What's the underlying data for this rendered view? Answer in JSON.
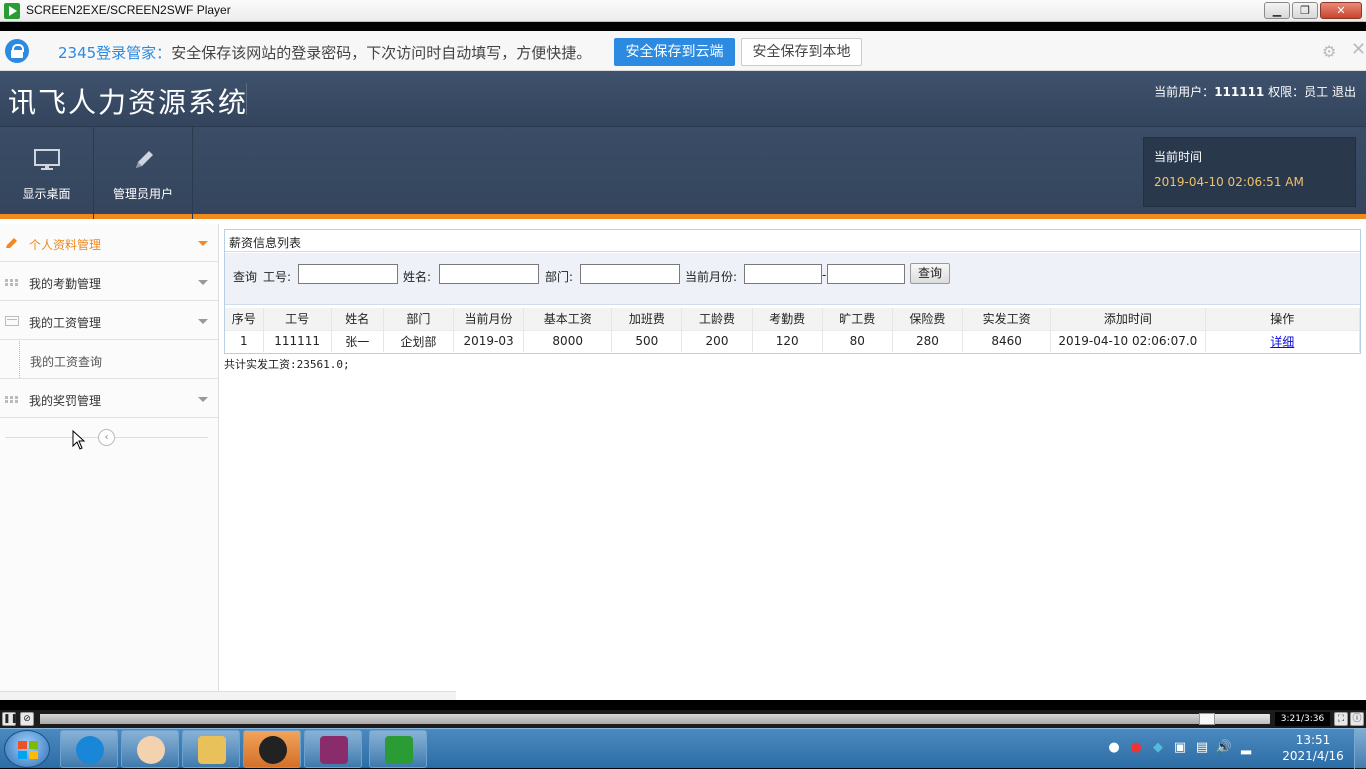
{
  "window": {
    "title": "SCREEN2EXE/SCREEN2SWF Player"
  },
  "password_bar": {
    "brand": "2345登录管家：",
    "message": "安全保存该网站的登录密码，下次访问时自动填写，方便快捷。",
    "save_cloud_label": "安全保存到云端",
    "save_local_label": "安全保存到本地"
  },
  "header": {
    "system_name": "讯飞人力资源系统",
    "user_label": "当前用户：",
    "user_id": "111111",
    "role_label": "权限：",
    "role": "员工",
    "logout_label": "退出"
  },
  "toolbar": {
    "items": [
      {
        "label": "显示桌面",
        "icon": "monitor-icon"
      },
      {
        "label": "管理员用户",
        "icon": "pencil-icon"
      }
    ],
    "time_title": "当前时间",
    "time_value": "2019-04-10 02:06:51 AM"
  },
  "sidebar": {
    "items": [
      {
        "label": "个人资料管理",
        "icon": "pencil-icon",
        "active": true
      },
      {
        "label": "我的考勤管理",
        "icon": "grid-icon"
      },
      {
        "label": "我的工资管理",
        "icon": "card-icon"
      },
      {
        "label": "我的工资查询",
        "sub": true
      },
      {
        "label": "我的奖罚管理",
        "icon": "grid-icon"
      }
    ]
  },
  "main": {
    "panel_title": "薪资信息列表",
    "search": {
      "query_label": "查询",
      "id_label": "工号:",
      "name_label": "姓名:",
      "dept_label": "部门:",
      "month_label": "当前月份:",
      "month_sep": "-",
      "button_label": "查询"
    },
    "table": {
      "columns": [
        "序号",
        "工号",
        "姓名",
        "部门",
        "当前月份",
        "基本工资",
        "加班费",
        "工龄费",
        "考勤费",
        "旷工费",
        "保险费",
        "实发工资",
        "添加时间",
        "操作"
      ],
      "rows": [
        [
          "1",
          "111111",
          "张一",
          "企划部",
          "2019-03",
          "8000",
          "500",
          "200",
          "120",
          "80",
          "280",
          "8460",
          "2019-04-10 02:06:07.0",
          "详细"
        ]
      ]
    },
    "total_text": "共计实发工资:23561.0;"
  },
  "player": {
    "time": "3:21/3:36",
    "progress": 0.955
  },
  "taskbar": {
    "clock_time": "13:51",
    "clock_date": "2021/4/16",
    "buttons": [
      "sogou-icon",
      "conan-icon",
      "explorer-icon",
      "hacker-icon",
      "winrar-icon",
      "screen2swf-icon"
    ]
  },
  "colors": {
    "accent": "#f08a1e",
    "header": "#3b4c66",
    "brand_blue": "#2c8ae0"
  }
}
